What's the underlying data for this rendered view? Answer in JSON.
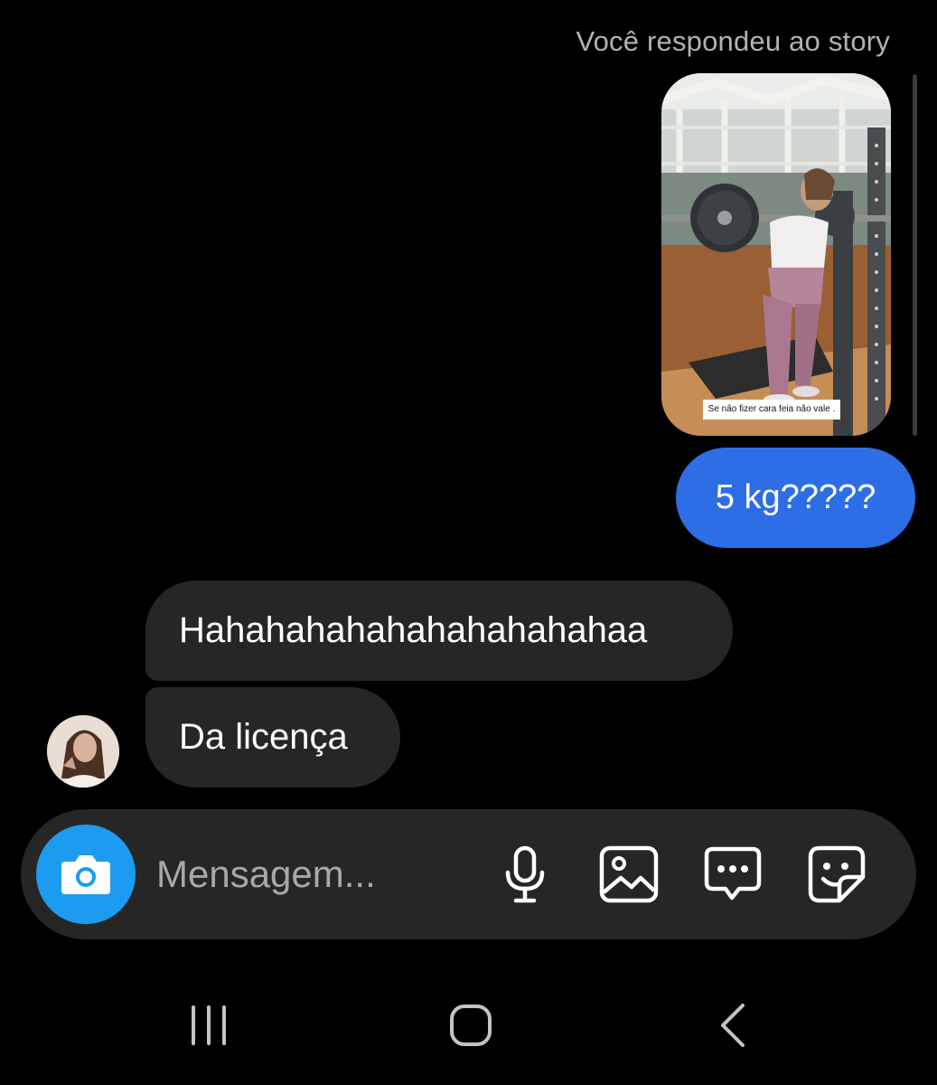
{
  "thread": {
    "story_reply_caption": "Você respondeu ao story",
    "story": {
      "sticker_text": "Se não fizer cara feia não vale ."
    },
    "messages": [
      {
        "from": "me",
        "text": "5 kg?????"
      },
      {
        "from": "them",
        "text": "Hahahahahahahahahahahaa"
      },
      {
        "from": "them",
        "text": "Da licença"
      }
    ]
  },
  "composer": {
    "placeholder": "Mensagem...",
    "icons": [
      "camera-icon",
      "microphone-icon",
      "gallery-icon",
      "chat-bubble-icon",
      "sticker-icon"
    ]
  },
  "navbar": {
    "icons": [
      "recents-icon",
      "home-icon",
      "back-icon"
    ]
  },
  "colors": {
    "background": "#000000",
    "sent_bubble": "#2d6ee6",
    "received_bubble": "#262626",
    "camera_button": "#1d9bf0",
    "caption": "#b3b3b3"
  }
}
